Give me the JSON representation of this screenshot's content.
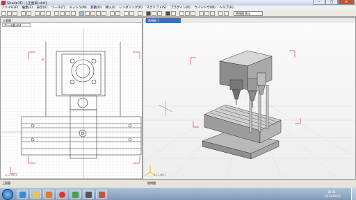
{
  "window": {
    "title": "Shade3D - [正面図.shd]",
    "min_label": "–",
    "max_label": "□",
    "close_label": "✕"
  },
  "menu": [
    "ファイル(F)",
    "編集(E)",
    "表示(V)",
    "ツール(T)",
    "メッシュ(M)",
    "移動(O)",
    "挿入(I)",
    "レンダリング(R)",
    "スクリプト(S)",
    "プラグイン(P)",
    "ウインドウ(W)",
    "ヘルプ(H)"
  ],
  "toolbar": {
    "view_mode": "透視図 表示"
  },
  "left_panel": {
    "title": "上面図",
    "tab": "ボール盤.shd",
    "coord": "x:12.0611"
  },
  "right_panel": {
    "title": "透視図",
    "tab": "透視図 1",
    "coord": "x:12.0611"
  },
  "status": {
    "left": "上面図",
    "right": "透視図"
  },
  "taskbar": {
    "time": "18:36",
    "date": "2013/09/22"
  },
  "colors": {
    "guide_red": "#e53935",
    "grid": "#d0d0d0",
    "taskbar": "#8aa4c4",
    "accent": "#3c6fb0"
  }
}
